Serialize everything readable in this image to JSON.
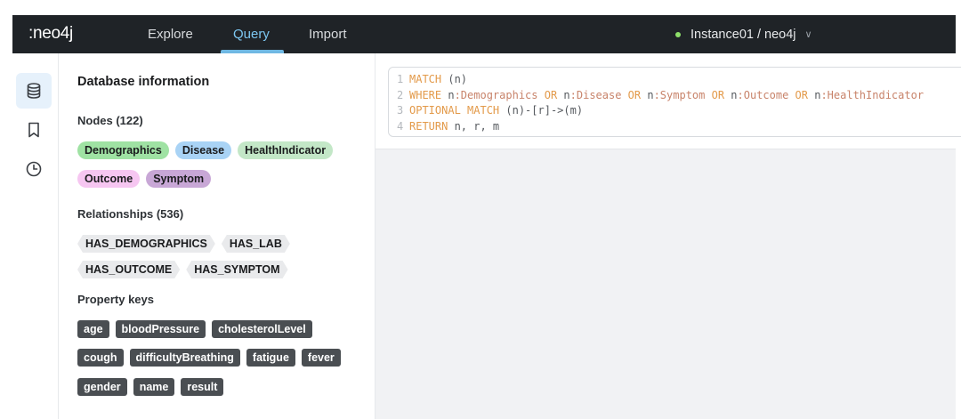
{
  "app": {
    "logo": ":neo4j",
    "nav": [
      "Explore",
      "Query",
      "Import"
    ],
    "active_nav": "Query",
    "instance": "Instance01 / neo4j",
    "instance_status_color": "#8ee06a"
  },
  "rail": {
    "icons": [
      "database-icon",
      "bookmark-icon",
      "history-icon"
    ],
    "active": "database-icon"
  },
  "db_info": {
    "title": "Database information",
    "nodes_title": "Nodes (122)",
    "node_labels": [
      {
        "name": "Demographics",
        "color": "#9fe2a3"
      },
      {
        "name": "Disease",
        "color": "#a9d3f5"
      },
      {
        "name": "HealthIndicator",
        "color": "#c3e7c7"
      },
      {
        "name": "Outcome",
        "color": "#f6c6f1"
      },
      {
        "name": "Symptom",
        "color": "#c8a7d6"
      }
    ],
    "relationships_title": "Relationships (536)",
    "relationships": [
      "HAS_DEMOGRAPHICS",
      "HAS_LAB",
      "HAS_OUTCOME",
      "HAS_SYMPTOM"
    ],
    "property_keys_title": "Property keys",
    "property_keys": [
      "age",
      "bloodPressure",
      "cholesterolLevel",
      "cough",
      "difficultyBreathing",
      "fatigue",
      "fever",
      "gender",
      "name",
      "result"
    ]
  },
  "editor": {
    "lines": [
      "MATCH (n)",
      "WHERE n:Demographics OR n:Disease OR n:Symptom OR n:Outcome OR n:HealthIndicator",
      "OPTIONAL MATCH (n)-[r]->(m)",
      "RETURN n, r, m"
    ]
  }
}
